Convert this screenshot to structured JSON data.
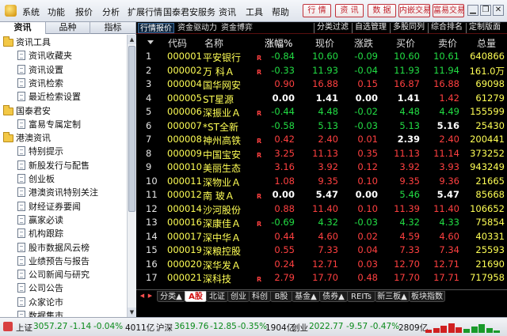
{
  "menubar": {
    "items": [
      "系统",
      "功能",
      "报价",
      "分析",
      "扩展行情",
      "国泰君安服务",
      "资讯",
      "工具",
      "帮助"
    ],
    "toolbar": [
      "行 情",
      "资 讯",
      "数 据",
      "内嵌交易",
      "富易交易"
    ],
    "window_controls": [
      "▁",
      "❐",
      "✕"
    ]
  },
  "left_panel": {
    "tabs": [
      "资讯",
      "品种",
      "指标"
    ],
    "tree": [
      {
        "type": "folder",
        "label": "资讯工具"
      },
      {
        "type": "doc",
        "label": "资讯收藏夹"
      },
      {
        "type": "doc",
        "label": "资讯设置"
      },
      {
        "type": "doc",
        "label": "资讯检索"
      },
      {
        "type": "doc",
        "label": "最近检索设置"
      },
      {
        "type": "folder",
        "label": "国泰君安"
      },
      {
        "type": "doc",
        "label": "富易专属定制"
      },
      {
        "type": "folder",
        "label": "港澳资讯"
      },
      {
        "type": "doc",
        "label": "特别提示"
      },
      {
        "type": "doc",
        "label": "新股发行与配售"
      },
      {
        "type": "doc",
        "label": "创业板"
      },
      {
        "type": "doc",
        "label": "港澳资讯特别关注"
      },
      {
        "type": "doc",
        "label": "财经证券要闻"
      },
      {
        "type": "doc",
        "label": "赢家必读"
      },
      {
        "type": "doc",
        "label": "机构跟踪"
      },
      {
        "type": "doc",
        "label": "股市数据风云榜"
      },
      {
        "type": "doc",
        "label": "业绩预告与报告"
      },
      {
        "type": "doc",
        "label": "公司新闻与研究"
      },
      {
        "type": "doc",
        "label": "公司公告"
      },
      {
        "type": "doc",
        "label": "众家论市"
      },
      {
        "type": "doc",
        "label": "数据集市"
      },
      {
        "type": "doc",
        "label": "股指期货"
      }
    ]
  },
  "quote": {
    "tabs_left": [
      "行情报价",
      "资金驱动力",
      "资金博弈"
    ],
    "tabs_right": [
      "分类过滤",
      "自选管理",
      "多股同列",
      "综合排名",
      "定制版面"
    ],
    "headers": [
      "代码",
      "名称",
      "涨幅%",
      "现价",
      "涨跌",
      "买价",
      "卖价",
      "总量"
    ],
    "rows": [
      {
        "num": "1",
        "code": "000001",
        "name": "平安银行",
        "flag": "R",
        "pct": "-0.84",
        "price": "10.60",
        "chg": "-0.09",
        "bid": "10.60",
        "ask": "10.61",
        "vol": "640866",
        "col": {
          "pct": "#22dd44",
          "price": "#22dd44",
          "chg": "#22dd44",
          "bid": "#22dd44",
          "ask": "#22dd44",
          "vol": "#ffff55"
        }
      },
      {
        "num": "2",
        "code": "000002",
        "name": "万 科Ａ",
        "flag": "R",
        "pct": "-0.33",
        "price": "11.93",
        "chg": "-0.04",
        "bid": "11.93",
        "ask": "11.94",
        "vol": "161.0万",
        "col": {
          "pct": "#22dd44",
          "price": "#22dd44",
          "chg": "#22dd44",
          "bid": "#22dd44",
          "ask": "#22dd44",
          "vol": "#ffff55"
        }
      },
      {
        "num": "3",
        "code": "000004",
        "name": "国华网安",
        "flag": "",
        "pct": "0.90",
        "price": "16.88",
        "chg": "0.15",
        "bid": "16.87",
        "ask": "16.88",
        "vol": "69098",
        "col": {
          "pct": "#ff4040",
          "price": "#ff4040",
          "chg": "#ff4040",
          "bid": "#ff4040",
          "ask": "#ff4040",
          "vol": "#ffff55"
        }
      },
      {
        "num": "4",
        "code": "000005",
        "name": "ST星源",
        "flag": "",
        "pct": "0.00",
        "price": "1.41",
        "chg": "0.00",
        "bid": "1.41",
        "ask": "1.42",
        "vol": "61279",
        "col": {
          "pct": "#ffffff",
          "price": "#ffffff",
          "chg": "#ffffff",
          "bid": "#ffffff",
          "ask": "#ff4040",
          "vol": "#ffff55"
        }
      },
      {
        "num": "5",
        "code": "000006",
        "name": "深振业Ａ",
        "flag": "R",
        "pct": "-0.44",
        "price": "4.48",
        "chg": "-0.02",
        "bid": "4.48",
        "ask": "4.49",
        "vol": "155599",
        "col": {
          "pct": "#22dd44",
          "price": "#22dd44",
          "chg": "#22dd44",
          "bid": "#22dd44",
          "ask": "#22dd44",
          "vol": "#ffff55"
        }
      },
      {
        "num": "6",
        "code": "000007",
        "name": "*ST全新",
        "flag": "",
        "pct": "-0.58",
        "price": "5.13",
        "chg": "-0.03",
        "bid": "5.13",
        "ask": "5.16",
        "vol": "25430",
        "col": {
          "pct": "#22dd44",
          "price": "#22dd44",
          "chg": "#22dd44",
          "bid": "#22dd44",
          "ask": "#ffffff",
          "vol": "#ffff55"
        }
      },
      {
        "num": "7",
        "code": "000008",
        "name": "神州高铁",
        "flag": "R",
        "pct": "0.42",
        "price": "2.40",
        "chg": "0.01",
        "bid": "2.39",
        "ask": "2.40",
        "vol": "200441",
        "col": {
          "pct": "#ff4040",
          "price": "#ff4040",
          "chg": "#ff4040",
          "bid": "#ffffff",
          "ask": "#ff4040",
          "vol": "#ffff55"
        }
      },
      {
        "num": "8",
        "code": "000009",
        "name": "中国宝安",
        "flag": "R",
        "pct": "3.25",
        "price": "11.13",
        "chg": "0.35",
        "bid": "11.13",
        "ask": "11.14",
        "vol": "373252",
        "col": {
          "pct": "#ff4040",
          "price": "#ff4040",
          "chg": "#ff4040",
          "bid": "#ff4040",
          "ask": "#ff4040",
          "vol": "#ffff55"
        }
      },
      {
        "num": "9",
        "code": "000010",
        "name": "美丽生态",
        "flag": "",
        "pct": "3.16",
        "price": "3.92",
        "chg": "0.12",
        "bid": "3.92",
        "ask": "3.93",
        "vol": "943249",
        "col": {
          "pct": "#ff4040",
          "price": "#ff4040",
          "chg": "#ff4040",
          "bid": "#ff4040",
          "ask": "#ff4040",
          "vol": "#ffff55"
        }
      },
      {
        "num": "10",
        "code": "000011",
        "name": "深物业Ａ",
        "flag": "",
        "pct": "1.08",
        "price": "9.35",
        "chg": "0.10",
        "bid": "9.35",
        "ask": "9.36",
        "vol": "21665",
        "col": {
          "pct": "#ff4040",
          "price": "#ff4040",
          "chg": "#ff4040",
          "bid": "#ff4040",
          "ask": "#ff4040",
          "vol": "#ffff55"
        }
      },
      {
        "num": "11",
        "code": "000012",
        "name": "南 玻Ａ",
        "flag": "R",
        "pct": "0.00",
        "price": "5.47",
        "chg": "0.00",
        "bid": "5.46",
        "ask": "5.47",
        "vol": "85668",
        "col": {
          "pct": "#ffffff",
          "price": "#ffffff",
          "chg": "#ffffff",
          "bid": "#22dd44",
          "ask": "#ffffff",
          "vol": "#ffff55"
        }
      },
      {
        "num": "12",
        "code": "000014",
        "name": "沙河股份",
        "flag": "",
        "pct": "0.88",
        "price": "11.40",
        "chg": "0.10",
        "bid": "11.39",
        "ask": "11.40",
        "vol": "106652",
        "col": {
          "pct": "#ff4040",
          "price": "#ff4040",
          "chg": "#ff4040",
          "bid": "#ff4040",
          "ask": "#ff4040",
          "vol": "#ffff55"
        }
      },
      {
        "num": "13",
        "code": "000016",
        "name": "深康佳Ａ",
        "flag": "R",
        "pct": "-0.69",
        "price": "4.32",
        "chg": "-0.03",
        "bid": "4.32",
        "ask": "4.33",
        "vol": "75854",
        "col": {
          "pct": "#22dd44",
          "price": "#22dd44",
          "chg": "#22dd44",
          "bid": "#22dd44",
          "ask": "#22dd44",
          "vol": "#ffff55"
        }
      },
      {
        "num": "14",
        "code": "000017",
        "name": "深中华Ａ",
        "flag": "",
        "pct": "0.44",
        "price": "4.60",
        "chg": "0.02",
        "bid": "4.59",
        "ask": "4.60",
        "vol": "40331",
        "col": {
          "pct": "#ff4040",
          "price": "#ff4040",
          "chg": "#ff4040",
          "bid": "#ff4040",
          "ask": "#ff4040",
          "vol": "#ffff55"
        }
      },
      {
        "num": "15",
        "code": "000019",
        "name": "深粮控股",
        "flag": "",
        "pct": "0.55",
        "price": "7.33",
        "chg": "0.04",
        "bid": "7.33",
        "ask": "7.34",
        "vol": "25593",
        "col": {
          "pct": "#ff4040",
          "price": "#ff4040",
          "chg": "#ff4040",
          "bid": "#ff4040",
          "ask": "#ff4040",
          "vol": "#ffff55"
        }
      },
      {
        "num": "16",
        "code": "000020",
        "name": "深华发Ａ",
        "flag": "",
        "pct": "0.24",
        "price": "12.71",
        "chg": "0.03",
        "bid": "12.70",
        "ask": "12.71",
        "vol": "21690",
        "col": {
          "pct": "#ff4040",
          "price": "#ff4040",
          "chg": "#ff4040",
          "bid": "#ff4040",
          "ask": "#ff4040",
          "vol": "#ffff55"
        }
      },
      {
        "num": "17",
        "code": "000021",
        "name": "深科技",
        "flag": "R",
        "pct": "2.79",
        "price": "17.70",
        "chg": "0.48",
        "bid": "17.70",
        "ask": "17.71",
        "vol": "717958",
        "col": {
          "pct": "#ff4040",
          "price": "#ff4040",
          "chg": "#ff4040",
          "bid": "#ff4040",
          "ask": "#ff4040",
          "vol": "#ffff55"
        }
      }
    ],
    "market_tabs": [
      "分类▲",
      "A股",
      "北证",
      "创业",
      "科创",
      "B股",
      "基金▲",
      "债券▲",
      "REITs",
      "新三板▲",
      "板块指数"
    ],
    "active_market_tab": "A股"
  },
  "statusbar": {
    "sh_label": "上证",
    "sh_index": "3057.27",
    "sh_chg": "-1.14",
    "sh_pct": "-0.04%",
    "sh_amount": "4011亿",
    "sz_label": "沪深",
    "sz_index": "3619.76",
    "sz_chg": "-12.85",
    "sz_pct": "-0.35%",
    "sz_amount": "1904亿",
    "cy_label": "创业",
    "cy_index": "2022.77",
    "cy_chg": "-9.57",
    "cy_pct": "-0.47%",
    "cy_amount": "2809亿"
  },
  "colors": {
    "up": "#ff4040",
    "down": "#22dd44",
    "flat": "#ffffff",
    "code": "#ffff55",
    "status_green": "#0a8a1a"
  }
}
